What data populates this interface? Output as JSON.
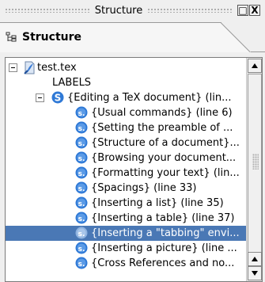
{
  "dock": {
    "title": "Structure",
    "float_glyph": "□",
    "close_glyph": "X"
  },
  "tab": {
    "label": "Structure",
    "icon": "structure-icon"
  },
  "tree": {
    "root": {
      "label": "test.tex",
      "icon": "tex-file-icon"
    },
    "labels_node": {
      "label": "LABELS"
    },
    "section": {
      "label": "{Editing a TeX document}  (lin...",
      "icon": "section-icon"
    },
    "subsections": [
      {
        "label": "{Usual commands}  (line 6)"
      },
      {
        "label": "{Setting the preamble of ..."
      },
      {
        "label": "{Structure of a document}..."
      },
      {
        "label": "{Browsing your document..."
      },
      {
        "label": "{Formatting your text}  (lin..."
      },
      {
        "label": "{Spacings}  (line 33)"
      },
      {
        "label": "{Inserting a list}  (line 35)"
      },
      {
        "label": "{Inserting a table}  (line 37)"
      },
      {
        "label": "{Inserting a \"tabbing\" envi...",
        "selected": true
      },
      {
        "label": "{Inserting a picture}  (line ..."
      },
      {
        "label": "{Cross References and no..."
      }
    ]
  },
  "colors": {
    "selection": "#4a78b5",
    "section_icon": "#2f79d6"
  }
}
